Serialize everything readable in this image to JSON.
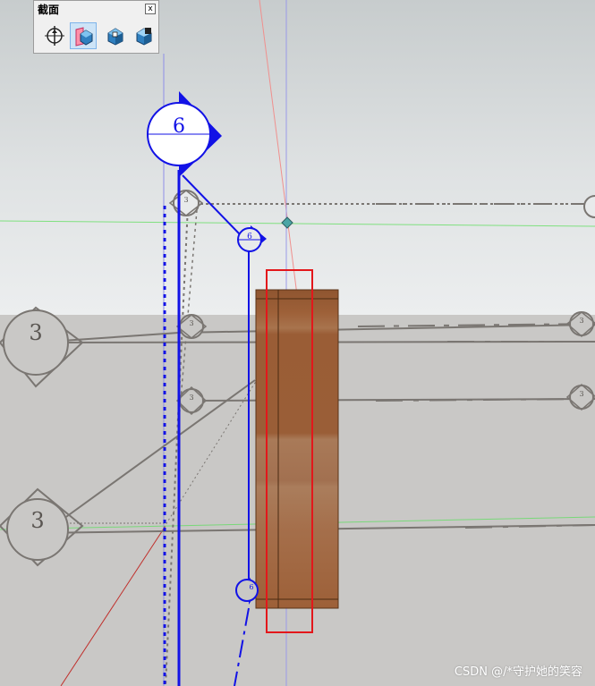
{
  "toolbar": {
    "title": "截面",
    "close_label": "x",
    "buttons": [
      {
        "icon": "section-plane-icon",
        "active": false
      },
      {
        "icon": "display-section-planes-icon",
        "active": true
      },
      {
        "icon": "display-section-cuts-icon",
        "active": false
      },
      {
        "icon": "section-fill-icon",
        "active": false
      }
    ]
  },
  "scene": {
    "section_markers": {
      "large_blue": "6",
      "small_blue": "6",
      "bottom_blue": "6",
      "left_big_top": "3",
      "left_big_bottom": "3",
      "small_gray": [
        "3",
        "3",
        "3",
        "3",
        "3"
      ]
    },
    "colors": {
      "sky_top": "#c7cccd",
      "ground": "#c9c8c6",
      "section_blue": "#1212e6",
      "section_gray": "#7a7672",
      "wall_brown": "#9a5e36",
      "highlight_red": "#e3171b"
    }
  },
  "watermark": "CSDN @/*守护她的笑容"
}
